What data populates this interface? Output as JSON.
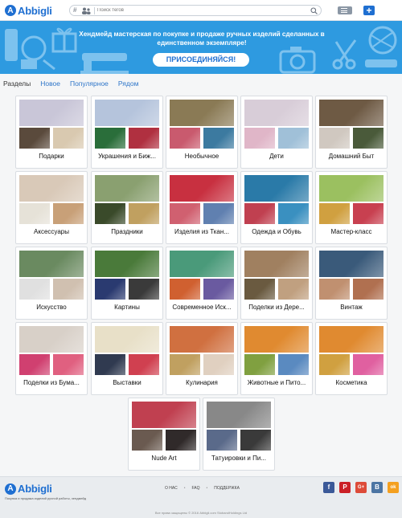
{
  "header": {
    "logo_letter": "A",
    "logo_text": "Abbigli",
    "search_hash": "#",
    "search_placeholder": "Поиск тегов",
    "add_label": "+"
  },
  "banner": {
    "title": "Хендмейд мастерская по покупке и продаже ручных изделий сделанных в единственном экземпляре!",
    "join_label": "ПРИСОЕДИНЯЙСЯ!"
  },
  "tabs": [
    "Разделы",
    "Новое",
    "Популярное",
    "Рядом"
  ],
  "categories": [
    {
      "name": "Подарки",
      "colors": [
        "#c9c6d8",
        "#5a4a3c",
        "#d9c9b0"
      ]
    },
    {
      "name": "Украшения и Биж...",
      "colors": [
        "#b5c4dc",
        "#2a6e3a",
        "#b03040"
      ]
    },
    {
      "name": "Необычное",
      "colors": [
        "#8a7a55",
        "#c95a6e",
        "#3c7aa0"
      ]
    },
    {
      "name": "Дети",
      "colors": [
        "#d8cdd8",
        "#e0b6c8",
        "#a0c0d8"
      ]
    },
    {
      "name": "Домашний Быт",
      "colors": [
        "#6e5a44",
        "#d0c8c0",
        "#4a5a3a"
      ]
    },
    {
      "name": "Аксессуары",
      "colors": [
        "#d9c9b8",
        "#e6e2d8",
        "#c8a078"
      ]
    },
    {
      "name": "Праздники",
      "colors": [
        "#8aa070",
        "#3a4a2a",
        "#c0a060"
      ]
    },
    {
      "name": "Изделия из Ткан...",
      "colors": [
        "#c83040",
        "#d06070",
        "#6080b0"
      ]
    },
    {
      "name": "Одежда и Обувь",
      "colors": [
        "#2a7aa8",
        "#c04050",
        "#3a90c0"
      ]
    },
    {
      "name": "Мастер-класс",
      "colors": [
        "#9bc060",
        "#d0a040",
        "#c84050"
      ]
    },
    {
      "name": "Искусство",
      "colors": [
        "#6a8a60",
        "#e0e0e0",
        "#d0c0b0"
      ]
    },
    {
      "name": "Картины",
      "colors": [
        "#4a7a3a",
        "#2a3a70",
        "#3a3a3a"
      ]
    },
    {
      "name": "Современное Иск...",
      "colors": [
        "#4a9a7a",
        "#d06030",
        "#6a5aa0"
      ]
    },
    {
      "name": "Поделки из Дере...",
      "colors": [
        "#a08060",
        "#6a5a40",
        "#c0a080"
      ]
    },
    {
      "name": "Винтаж",
      "colors": [
        "#3a5a7a",
        "#c09070",
        "#b07050"
      ]
    },
    {
      "name": "Поделки из Бума...",
      "colors": [
        "#d8d0c8",
        "#d04070",
        "#e06080"
      ]
    },
    {
      "name": "Выставки",
      "colors": [
        "#e8e0c8",
        "#303a50",
        "#d04050"
      ]
    },
    {
      "name": "Кулинария",
      "colors": [
        "#d07040",
        "#c0a060",
        "#e0d0c0"
      ]
    },
    {
      "name": "Животные и Пито...",
      "colors": [
        "#e08a30",
        "#80a040",
        "#5a8ac0"
      ]
    },
    {
      "name": "Косметика",
      "colors": [
        "#e08a30",
        "#d0a040",
        "#e060a0"
      ]
    },
    {
      "name": "Nude Art",
      "colors": [
        "#c04050",
        "#6a5a50",
        "#302a2a"
      ]
    },
    {
      "name": "Татуировки и Пи...",
      "colors": [
        "#888888",
        "#5a6a8a",
        "#3a3a3a"
      ]
    }
  ],
  "footer": {
    "tagline": "Покупка и продажа изделий ручной работы, хендмейд",
    "links": [
      "О НАС",
      "FAQ",
      "ПОДДЕРЖКА"
    ],
    "social": [
      {
        "name": "facebook",
        "glyph": "f",
        "color": "#3b5998"
      },
      {
        "name": "pinterest",
        "glyph": "P",
        "color": "#cb2027"
      },
      {
        "name": "google-plus",
        "glyph": "G+",
        "color": "#dd4b39"
      },
      {
        "name": "vk",
        "glyph": "B",
        "color": "#4c75a3"
      },
      {
        "name": "odnoklassniki",
        "glyph": "ok",
        "color": "#f4a020"
      }
    ],
    "copyright": "Все права защищены © 2016 Abbigli.com StobandHoldings Ltd"
  }
}
